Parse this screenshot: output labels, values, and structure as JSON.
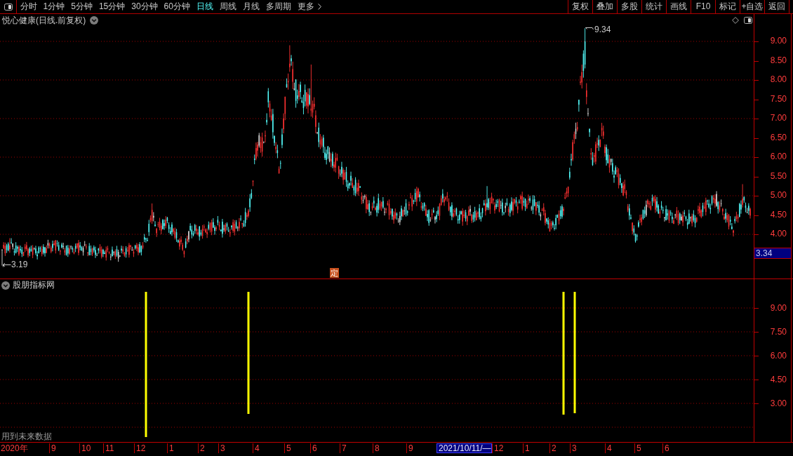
{
  "toolbar": {
    "periods": [
      {
        "label": "分时",
        "selected": false
      },
      {
        "label": "1分钟",
        "selected": false
      },
      {
        "label": "5分钟",
        "selected": false
      },
      {
        "label": "15分钟",
        "selected": false
      },
      {
        "label": "30分钟",
        "selected": false
      },
      {
        "label": "60分钟",
        "selected": false
      },
      {
        "label": "日线",
        "selected": true
      },
      {
        "label": "周线",
        "selected": false
      },
      {
        "label": "月线",
        "selected": false
      },
      {
        "label": "多周期",
        "selected": false
      }
    ],
    "more": "更多",
    "actions": [
      "复权",
      "叠加",
      "多股",
      "统计",
      "画线",
      "F10",
      "标记",
      "+自选",
      "返回"
    ]
  },
  "price_panel": {
    "title": "悦心健康(日线.前复权)",
    "high_label": "9.34",
    "low_label": "3.19",
    "marker": "定",
    "axis_labels": [
      "9.00",
      "8.50",
      "8.00",
      "7.50",
      "7.00",
      "6.50",
      "6.00",
      "5.50",
      "5.00",
      "4.50",
      "4.00"
    ],
    "cursor_price": "3.34"
  },
  "indicator_panel": {
    "title": "股朋指标网",
    "axis_labels": [
      "9.00",
      "7.50",
      "6.00",
      "4.50",
      "3.00"
    ],
    "note": "用到未来数据"
  },
  "date_axis": [
    {
      "text": "2020年",
      "highlighted": false
    },
    {
      "text": "9",
      "highlighted": false
    },
    {
      "text": "10",
      "highlighted": false
    },
    {
      "text": "11",
      "highlighted": false
    },
    {
      "text": "12",
      "highlighted": false
    },
    {
      "text": "1",
      "highlighted": false
    },
    {
      "text": "2",
      "highlighted": false
    },
    {
      "text": "3",
      "highlighted": false
    },
    {
      "text": "4",
      "highlighted": false
    },
    {
      "text": "5",
      "highlighted": false
    },
    {
      "text": "6",
      "highlighted": false
    },
    {
      "text": "7",
      "highlighted": false
    },
    {
      "text": "8",
      "highlighted": false
    },
    {
      "text": "9",
      "highlighted": false
    },
    {
      "text": "2021/10/11/—",
      "highlighted": true
    },
    {
      "text": "12",
      "highlighted": false
    },
    {
      "text": "1",
      "highlighted": false
    },
    {
      "text": "2",
      "highlighted": false
    },
    {
      "text": "3",
      "highlighted": false
    },
    {
      "text": "4",
      "highlighted": false
    },
    {
      "text": "5",
      "highlighted": false
    },
    {
      "text": "6",
      "highlighted": false
    }
  ]
}
